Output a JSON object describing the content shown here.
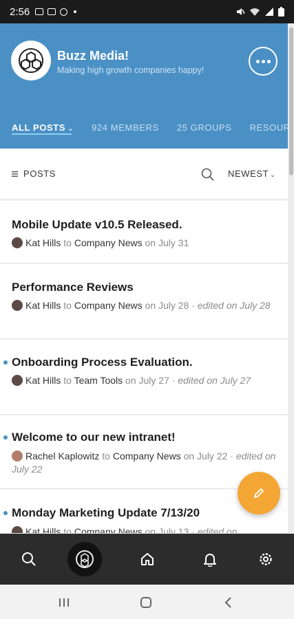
{
  "status_bar": {
    "time": "2:56"
  },
  "header": {
    "org_name": "Buzz Media!",
    "tagline": "Making high growth companies happy!",
    "tabs": [
      {
        "label": "ALL POSTS"
      },
      {
        "label": "924 MEMBERS"
      },
      {
        "label": "25 GROUPS"
      },
      {
        "label": "RESOURCES"
      }
    ]
  },
  "filter_bar": {
    "posts_label": "POSTS",
    "sort_label": "NEWEST"
  },
  "posts": [
    {
      "title": "Mobile Update v10.5 Released.",
      "author": "Kat Hills",
      "to": "to",
      "group": "Company News",
      "date": "on July 31",
      "edited": "",
      "unread": false
    },
    {
      "title": "Performance Reviews",
      "author": "Kat Hills",
      "to": "to",
      "group": "Company News",
      "date": "on July 28 ·",
      "edited": "edited on July 28",
      "unread": false
    },
    {
      "title": "Onboarding Process Evaluation.",
      "author": "Kat Hills",
      "to": "to",
      "group": "Team Tools",
      "date": "on July 27 ·",
      "edited": "edited on July 27",
      "unread": true
    },
    {
      "title": "Welcome to our new intranet!",
      "author": "Rachel Kaplowitz",
      "to": "to",
      "group": "Company News",
      "date": "on July 22 ·",
      "edited": "edited on July 22",
      "unread": true
    },
    {
      "title": "Monday Marketing Update 7/13/20",
      "author": "Kat Hills",
      "to": "to",
      "group": "Company News",
      "date": "on July 13 ·",
      "edited": "edited on",
      "unread": true
    }
  ],
  "colors": {
    "header": "#4a90c5",
    "fab": "#f4a634",
    "bottom_nav": "#2c2c2c"
  },
  "icons": [
    "search-icon",
    "home-icon",
    "bell-icon",
    "gear-icon",
    "pencil-icon",
    "more-icon"
  ]
}
